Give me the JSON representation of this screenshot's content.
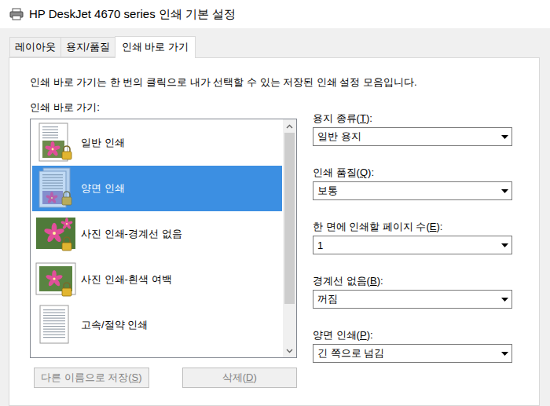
{
  "window": {
    "title": "HP DeskJet 4670 series 인쇄 기본 설정"
  },
  "tabs": [
    {
      "label": "레이아웃",
      "selected": false
    },
    {
      "label": "용지/품질",
      "selected": false
    },
    {
      "label": "인쇄 바로 가기",
      "selected": true
    }
  ],
  "description": "인쇄 바로 가기는 한 번의 클릭으로 내가 선택할 수 있는 저장된 인쇄 설정 모음입니다.",
  "shortcuts": {
    "label": "인쇄 바로 가기:",
    "items": [
      {
        "label": "일반 인쇄",
        "kind": "document",
        "locked": true,
        "selected": false
      },
      {
        "label": "양면 인쇄",
        "kind": "duplex",
        "locked": true,
        "selected": true
      },
      {
        "label": "사진 인쇄-경계선 없음",
        "kind": "photo",
        "locked": true,
        "selected": false
      },
      {
        "label": "사진 인쇄-흰색 여백",
        "kind": "framed",
        "locked": true,
        "selected": false
      },
      {
        "label": "고속/절약 인쇄",
        "kind": "text",
        "locked": false,
        "selected": false
      }
    ],
    "scrollbar": {
      "level": 0.81
    }
  },
  "settings": [
    {
      "label": "용지 종류(T):",
      "mnemonic": "T",
      "value": "일반 용지"
    },
    {
      "label": "인쇄 품질(Q):",
      "mnemonic": "Q",
      "value": "보통"
    },
    {
      "label": "한 면에 인쇄할 페이지 수(E):",
      "mnemonic": "E",
      "value": "1"
    },
    {
      "label": "경계선 없음(B):",
      "mnemonic": "B",
      "value": "꺼짐"
    },
    {
      "label": "양면 인쇄(P):",
      "mnemonic": "P",
      "value": "긴 쪽으로 넘김"
    }
  ],
  "buttons": [
    {
      "label": "다른 이름으로 저장(S)",
      "mnemonic": "S",
      "disabled": true
    },
    {
      "label": "삭제(D)",
      "mnemonic": "D",
      "disabled": true
    }
  ]
}
